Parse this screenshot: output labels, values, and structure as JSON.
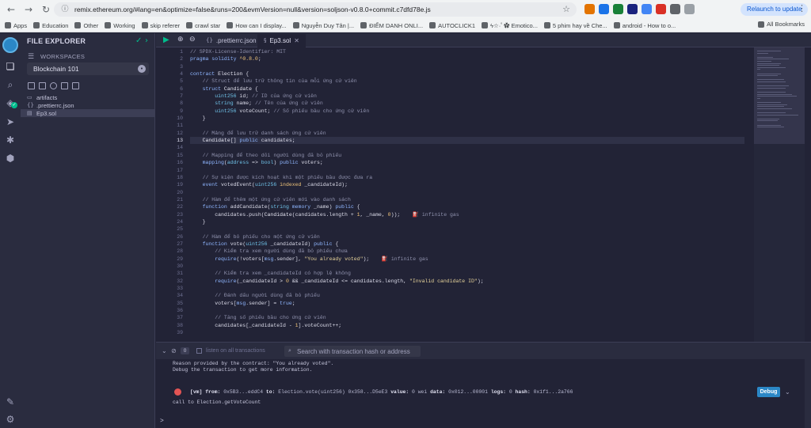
{
  "browser": {
    "url": "remix.ethereum.org/#lang=en&optimize=false&runs=200&evmVersion=null&version=soljson-v0.8.0+commit.c7dfd78e.js",
    "relaunch_label": "Relaunch to update",
    "bookmarks": [
      "Apps",
      "Education",
      "Other",
      "Working",
      "skip referer",
      "crawl star",
      "How can I display...",
      "Nguyễn Duy Tân |...",
      "ĐIỂM DANH ONLI...",
      "AUTOCLICK1",
      "ϟ☆·ﾟ✿ Emotico...",
      "5 phim hay về Che...",
      "android - How to o..."
    ],
    "all_bookmarks": "All Bookmarks"
  },
  "sidebar": {
    "title": "FILE EXPLORER",
    "workspaces_label": "WORKSPACES",
    "workspace_name": "Blockchain 101",
    "tree": [
      {
        "name": "artifacts",
        "icon": "folder-icon"
      },
      {
        "name": ".prettierrc.json",
        "icon": "braces-icon"
      },
      {
        "name": "Ep3.sol",
        "icon": "file-icon"
      }
    ]
  },
  "editor": {
    "tabs": [
      ".prettierrc.json",
      "Ep3.sol"
    ],
    "current_line": 13,
    "infinite_gas": "infinite gas"
  },
  "terminal": {
    "badge": "0",
    "listen_label": "listen on all transactions",
    "search_placeholder": "Search with transaction hash or address",
    "reason": "Reason provided by the contract: \"You already voted\".",
    "debug_hint": "Debug the transaction to get more information.",
    "tx": {
      "vm": "[vm]",
      "from_label": "from:",
      "from": "0x5B3...eddC4",
      "to_label": "to:",
      "to": "Election.vote(uint256) 0x358...D5eE3",
      "value_label": "value:",
      "value": "0 wei",
      "data_label": "data:",
      "data": "0x012...00001",
      "logs_label": "logs:",
      "logs": "0",
      "hash_label": "hash:",
      "hash": "0x1f1...2a766"
    },
    "debug_label": "Debug",
    "call_line": "call to Election.getVoteCount",
    "prompt": ">"
  },
  "colors": {
    "accent": "#00bc8c",
    "error": "#e35454",
    "debug": "#2b87c6"
  }
}
